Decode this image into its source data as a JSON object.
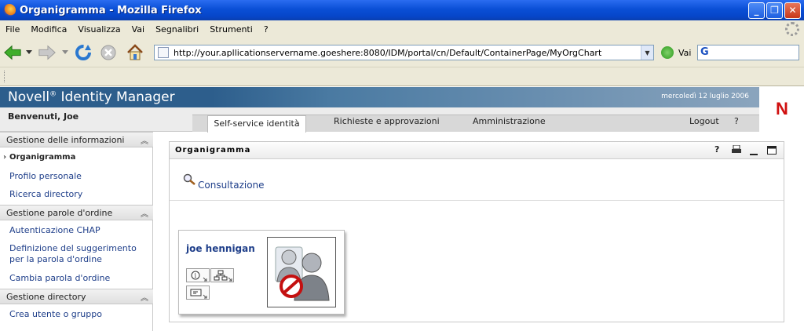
{
  "window": {
    "title": "Organigramma - Mozilla Firefox",
    "controls": {
      "minimize": "_",
      "restore": "❐",
      "close": "✕"
    }
  },
  "menu": [
    "File",
    "Modifica",
    "Visualizza",
    "Vai",
    "Segnalibri",
    "Strumenti",
    "?"
  ],
  "navbar": {
    "url": "http://your.apllicationservername.goeshere:8080/IDM/portal/cn/Default/ContainerPage/MyOrgChart",
    "go_label": "Vai",
    "search_value": ""
  },
  "portal": {
    "brand_name": "Novell",
    "brand_mark": "®",
    "brand_product": "Identity Manager",
    "date": "mercoledì 12 luglio 2006",
    "logo_letter": "N",
    "welcome": "Benvenuti, Joe",
    "tabs": [
      "Self-service identità",
      "Richieste e approvazioni",
      "Amministrazione"
    ],
    "logout": "Logout",
    "help": "?"
  },
  "sidebar": {
    "sections": [
      {
        "title": "Gestione delle informazioni",
        "items": [
          "Organigramma",
          "Profilo personale",
          "Ricerca directory"
        ]
      },
      {
        "title": "Gestione parole d'ordine",
        "items": [
          "Autenticazione CHAP",
          "Definizione del suggerimento per la parola d'ordine",
          "Cambia parola d'ordine"
        ]
      },
      {
        "title": "Gestione directory",
        "items": [
          "Crea utente o gruppo"
        ]
      }
    ]
  },
  "portlet": {
    "title": "Organigramma",
    "controls": [
      "?",
      "print-icon",
      "minimize-icon",
      "maximize-icon"
    ],
    "consult_label": "Consultazione",
    "card": {
      "name": "joe hennigan"
    }
  },
  "colors": {
    "title_bar": "#0a4fd6",
    "portal_header": "#2d5e8c",
    "link": "#1f3f8a",
    "logo_red": "#d01010"
  }
}
